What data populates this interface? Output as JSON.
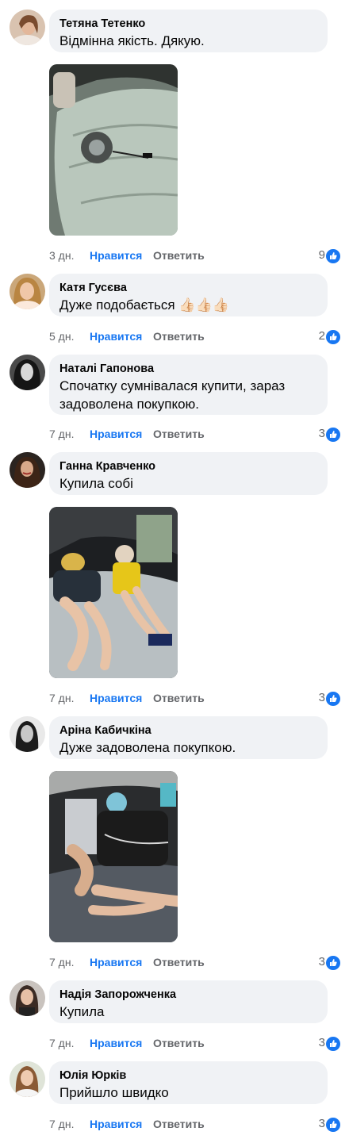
{
  "comments": [
    {
      "author": "Тетяна Тетенко",
      "text": "Відмінна якість. Дякую.",
      "time": "3 дн.",
      "like": "Нравится",
      "reply": "Ответить",
      "count": "9"
    },
    {
      "author": "Катя Гусєва",
      "text": "Дуже подобається 👍🏻👍🏻👍🏻",
      "time": "5 дн.",
      "like": "Нравится",
      "reply": "Ответить",
      "count": "2"
    },
    {
      "author": "Наталі Гапонова",
      "text": "Спочатку сумнівалася купити, зараз задоволена покупкою.",
      "time": "7 дн.",
      "like": "Нравится",
      "reply": "Ответить",
      "count": "3"
    },
    {
      "author": "Ганна Кравченко",
      "text": "Купила собі",
      "time": "7 дн.",
      "like": "Нравится",
      "reply": "Ответить",
      "count": "3"
    },
    {
      "author": "Аріна Кабичкіна",
      "text": "Дуже задоволена покупкою.",
      "time": "7 дн.",
      "like": "Нравится",
      "reply": "Ответить",
      "count": "3"
    },
    {
      "author": "Надія Запорожченка",
      "text": "Купила",
      "time": "7 дн.",
      "like": "Нравится",
      "reply": "Ответить",
      "count": "3"
    },
    {
      "author": "Юлія Юрків",
      "text": "Прийшло швидко",
      "time": "7 дн.",
      "like": "Нравится",
      "reply": "Ответить",
      "count": "3"
    }
  ],
  "colors": {
    "bubble": "#f0f2f5",
    "like": "#1877f2",
    "meta": "#65676b"
  },
  "icons": {
    "reaction": "like-reaction-icon"
  }
}
